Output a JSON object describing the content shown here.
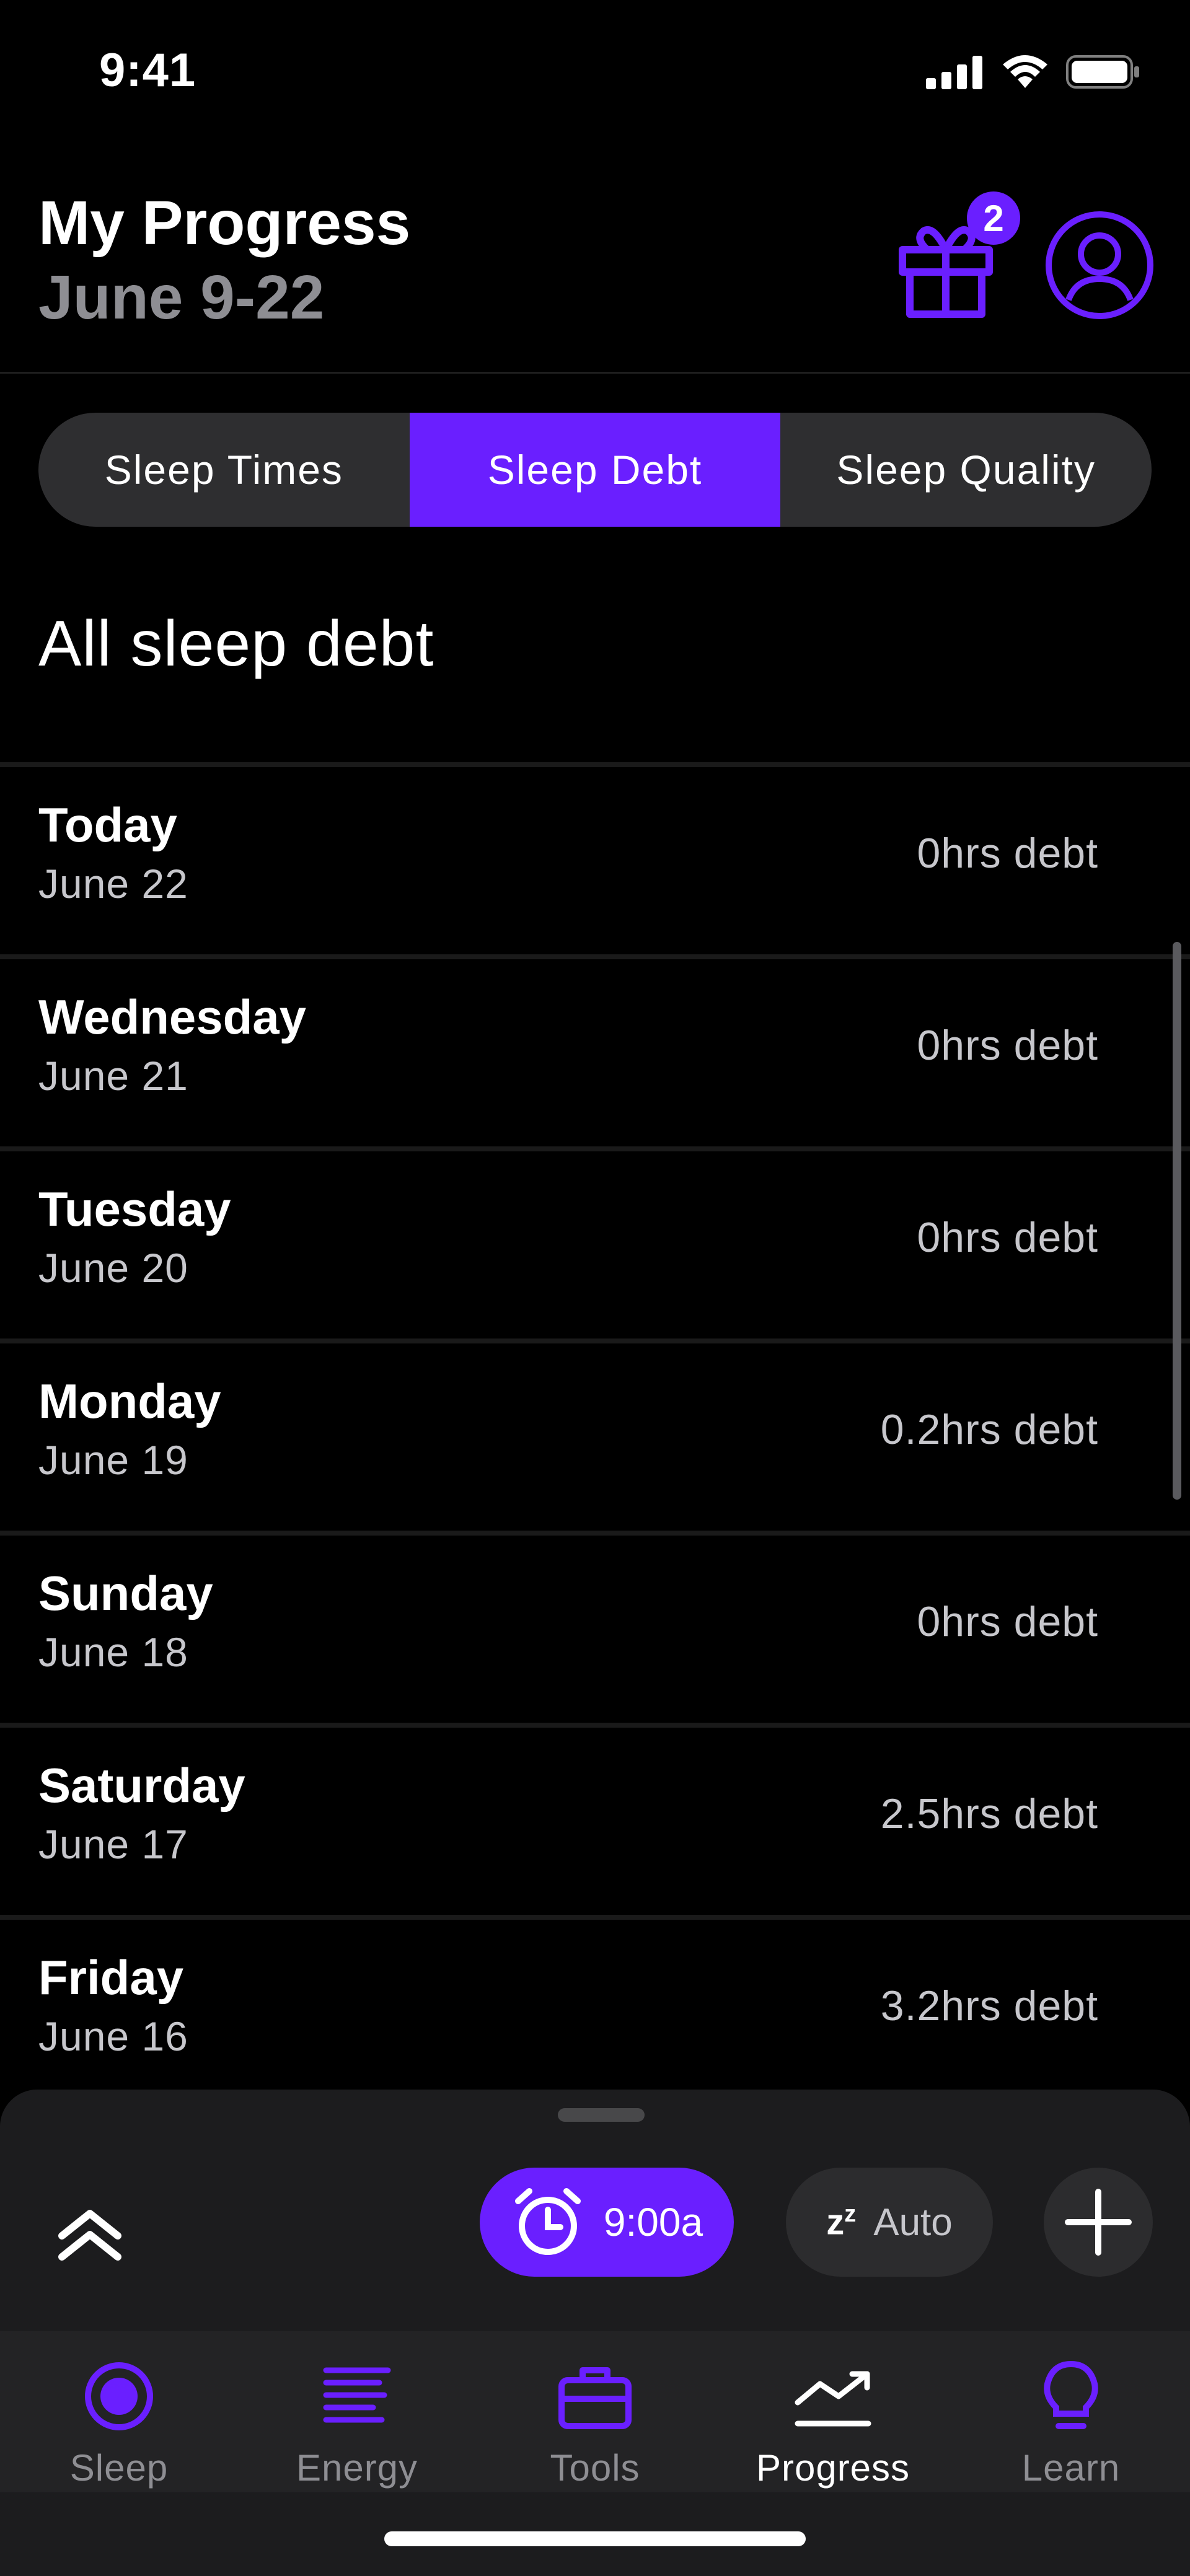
{
  "status_bar": {
    "time": "9:41"
  },
  "header": {
    "title": "My Progress",
    "subtitle": "June 9-22",
    "gift_badge_count": "2"
  },
  "tabs": [
    {
      "label": "Sleep Times",
      "active": false
    },
    {
      "label": "Sleep Debt",
      "active": true
    },
    {
      "label": "Sleep Quality",
      "active": false
    }
  ],
  "section_title": "All sleep debt",
  "debt_list": [
    {
      "day": "Today",
      "date": "June 22",
      "debt": "0hrs debt"
    },
    {
      "day": "Wednesday",
      "date": "June 21",
      "debt": "0hrs debt"
    },
    {
      "day": "Tuesday",
      "date": "June 20",
      "debt": "0hrs debt"
    },
    {
      "day": "Monday",
      "date": "June 19",
      "debt": "0.2hrs debt"
    },
    {
      "day": "Sunday",
      "date": "June 18",
      "debt": "0hrs debt"
    },
    {
      "day": "Saturday",
      "date": "June 17",
      "debt": "2.5hrs debt"
    },
    {
      "day": "Friday",
      "date": "June 16",
      "debt": "3.2hrs debt"
    }
  ],
  "quick_actions": {
    "alarm_time": "9:00a",
    "auto_label": "Auto"
  },
  "nav": [
    {
      "label": "Sleep",
      "icon": "sleep-icon"
    },
    {
      "label": "Energy",
      "icon": "energy-icon"
    },
    {
      "label": "Tools",
      "icon": "briefcase-icon"
    },
    {
      "label": "Progress",
      "icon": "trend-icon"
    },
    {
      "label": "Learn",
      "icon": "bulb-icon"
    }
  ],
  "colors": {
    "accent": "#6a1fff",
    "background": "#000000",
    "panel": "#1c1c1e"
  }
}
